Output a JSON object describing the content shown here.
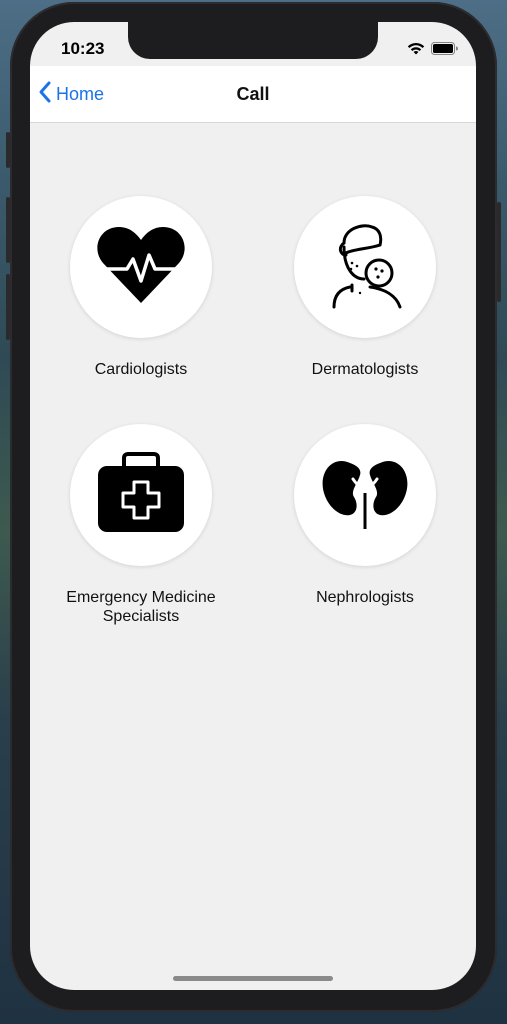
{
  "status_bar": {
    "time": "10:23",
    "icons": [
      "wifi-icon",
      "battery-icon"
    ]
  },
  "navbar": {
    "back_label": "Home",
    "back_icon": "chevron-left-icon",
    "title": "Call"
  },
  "categories": [
    {
      "label": "Cardiologists",
      "icon": "heart-pulse-icon"
    },
    {
      "label": "Dermatologists",
      "icon": "skin-face-icon"
    },
    {
      "label": "Emergency Medicine\nSpecialists",
      "icon": "first-aid-kit-icon"
    },
    {
      "label": "Nephrologists",
      "icon": "kidneys-icon"
    }
  ],
  "colors": {
    "accent": "#1a73e8",
    "background": "#f0f0f0",
    "navbar": "#ffffff"
  }
}
